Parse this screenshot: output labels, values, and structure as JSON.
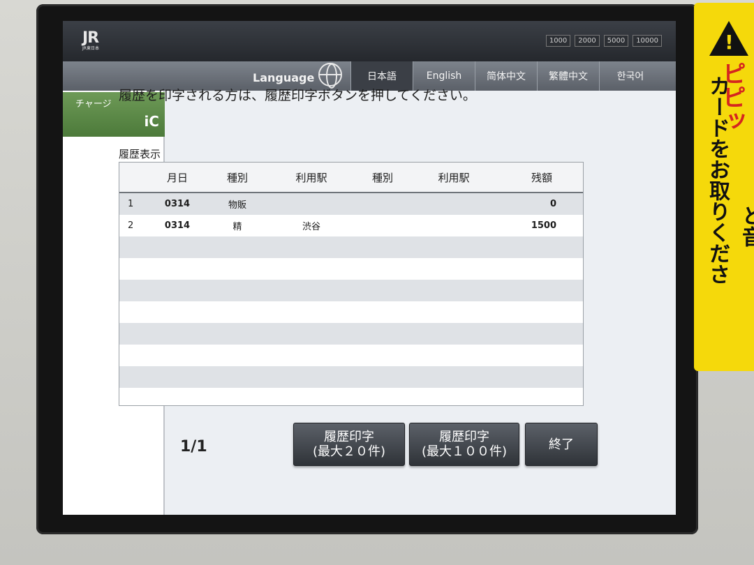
{
  "header": {
    "logo": "JR",
    "logo_sub": "JR東日本",
    "denominations": [
      "1000",
      "2000",
      "5000",
      "10000"
    ]
  },
  "language": {
    "title": "Language",
    "tabs": [
      "日本語",
      "English",
      "简体中文",
      "繁體中文",
      "한국어"
    ],
    "active_index": 0
  },
  "sidebar": {
    "charge_label": "チャージ",
    "ic_label": "iC"
  },
  "main": {
    "instruction": "履歴を印字される方は、履歴印字ボタンを押してください。",
    "section_label": "履歴表示",
    "columns": [
      "",
      "月日",
      "種別",
      "利用駅",
      "種別",
      "利用駅",
      "残額"
    ],
    "rows": [
      {
        "no": "1",
        "date": "0314",
        "kind": "物販",
        "station": "",
        "kind2": "",
        "station2": "",
        "balance": "0"
      },
      {
        "no": "2",
        "date": "0314",
        "kind": "精",
        "station": "渋谷",
        "kind2": "",
        "station2": "",
        "balance": "1500"
      }
    ],
    "page": "1/1"
  },
  "buttons": {
    "print20_line1": "履歴印字",
    "print20_line2": "(最大２０件)",
    "print100_line1": "履歴印字",
    "print100_line2": "(最大１００件)",
    "end": "終了"
  },
  "sticker": {
    "red_text": "ピピッ",
    "black_text": "カードをお取りくださ",
    "black_text_2": "と音"
  }
}
